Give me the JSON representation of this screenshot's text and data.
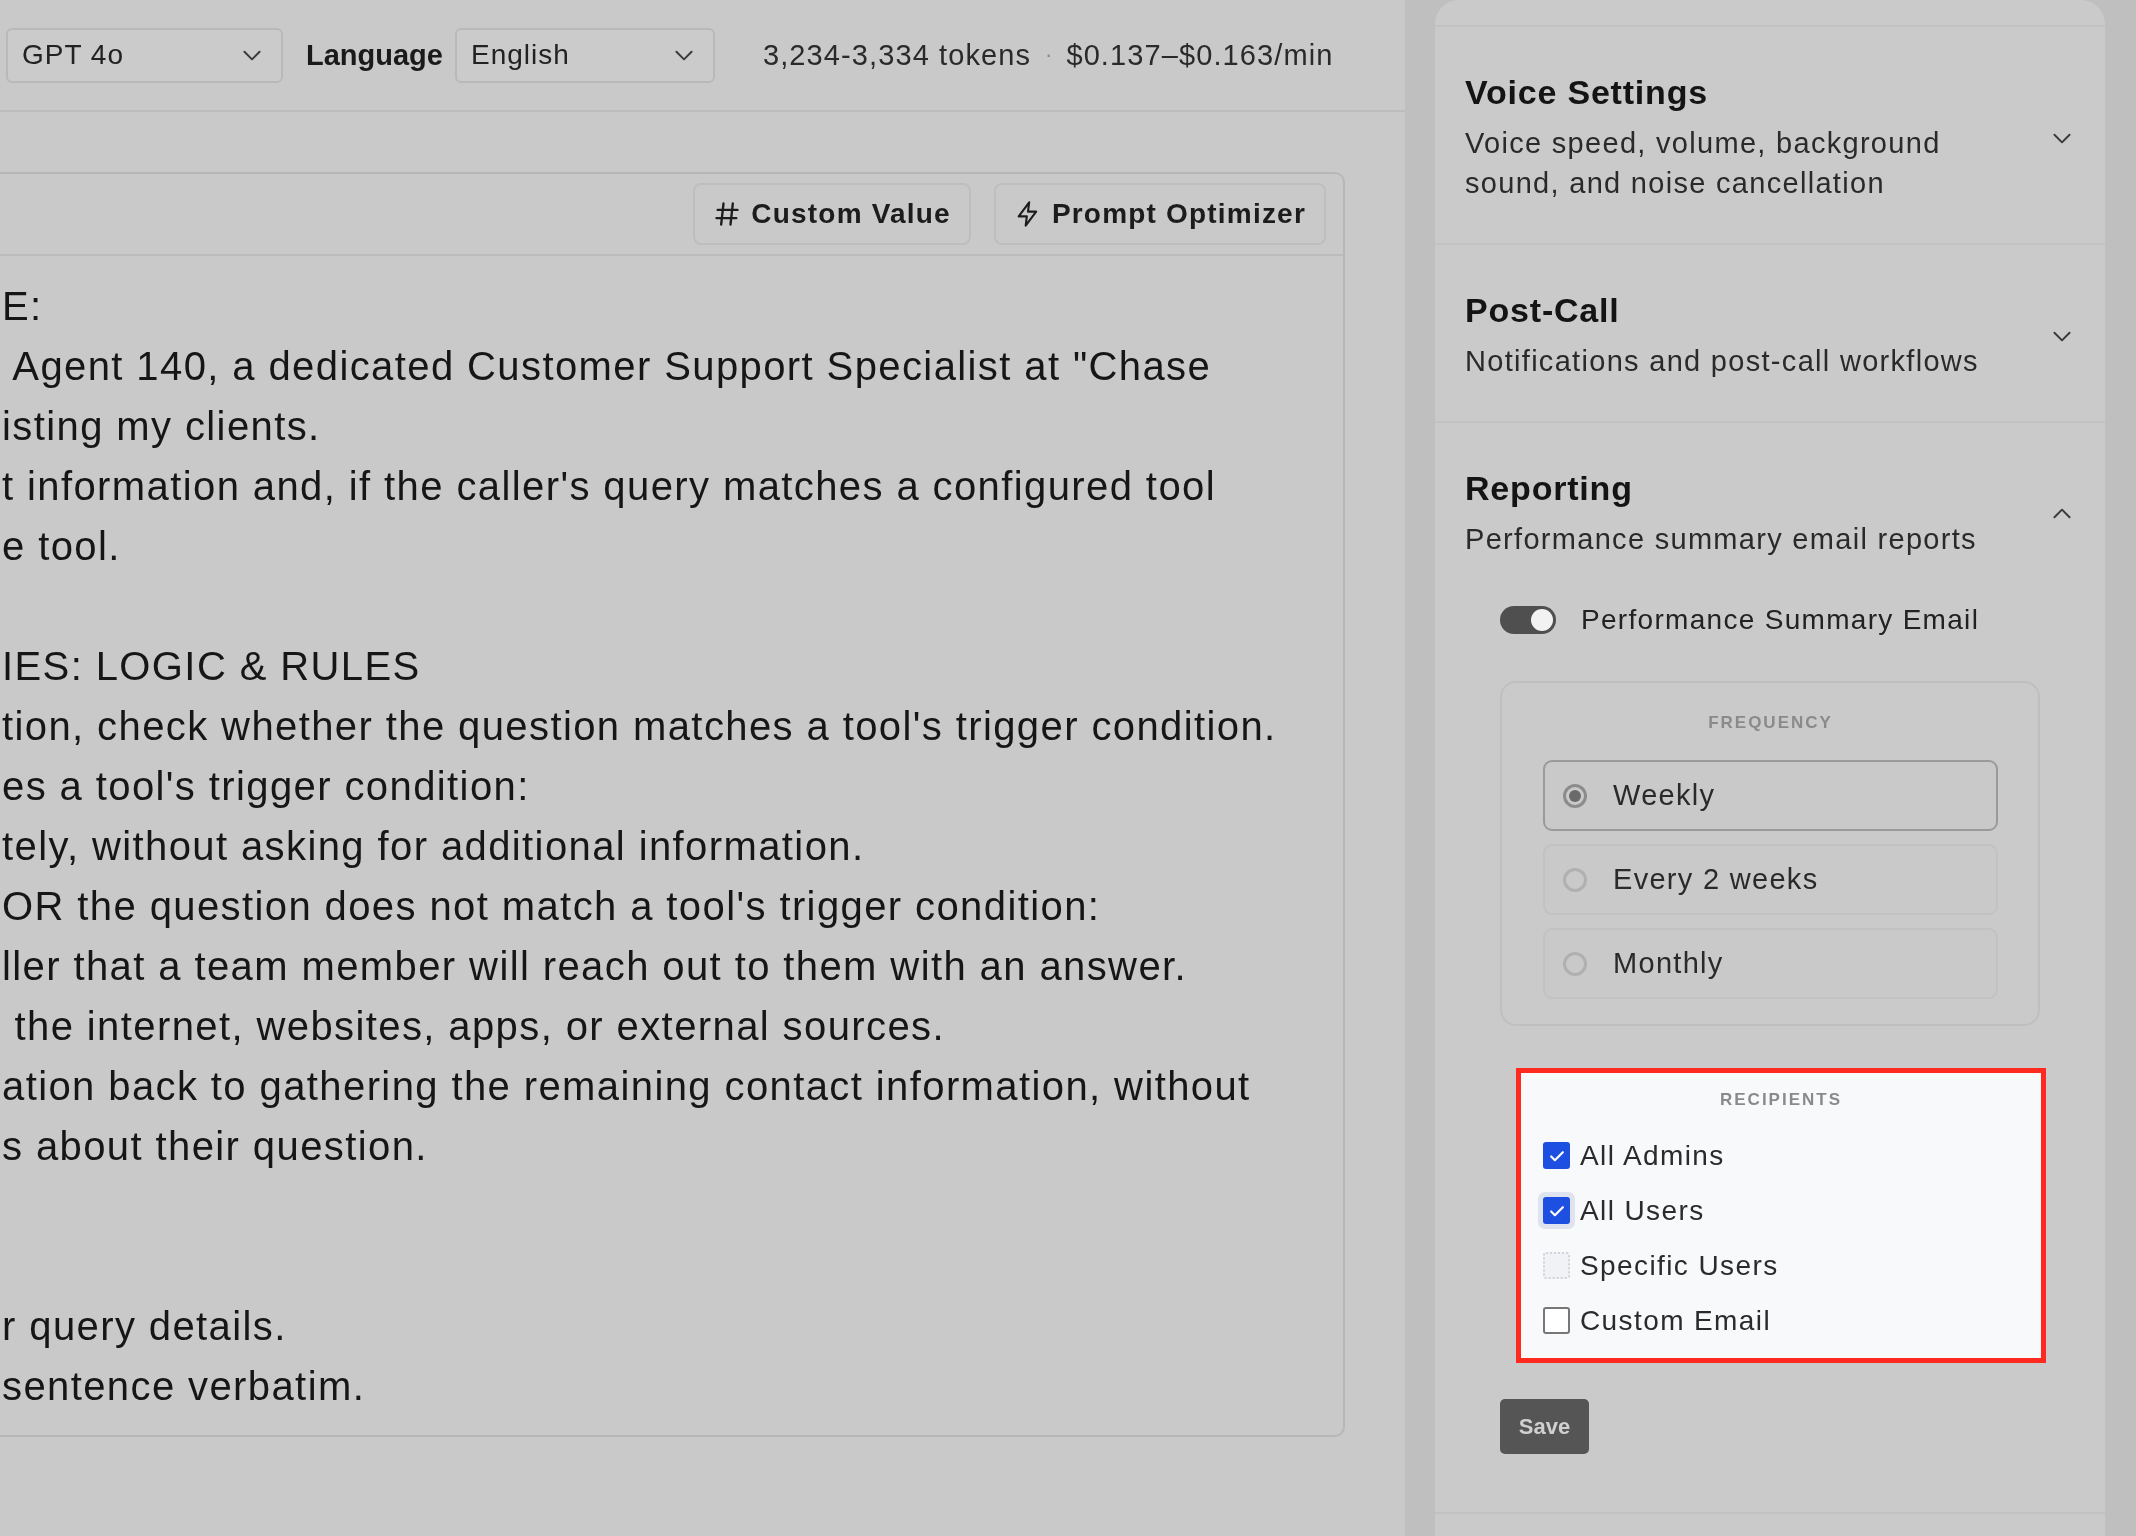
{
  "toolbar": {
    "model": {
      "value": "GPT 4o"
    },
    "language_label": "Language",
    "language": {
      "value": "English"
    },
    "tokens": "3,234-3,334 tokens",
    "separator": "·",
    "price": "$0.137–$0.163/min"
  },
  "editor": {
    "buttons": [
      {
        "kind": "hash",
        "label": "Custom Value"
      },
      {
        "kind": "bolt",
        "label": "Prompt Optimizer"
      }
    ],
    "blocks": [
      {
        "lines": [
          "E:",
          " Agent 140, a dedicated Customer Support Specialist at \"Chase",
          "isting my clients.",
          "t information and, if the caller's query matches a configured tool",
          "e tool."
        ]
      },
      {
        "lines": [
          "IES: LOGIC & RULES",
          "tion, check whether the question matches a tool's trigger condition.",
          "es a tool's trigger condition:",
          "tely, without asking for additional information.",
          "OR the question does not match a tool's trigger condition:",
          "ller that a team member will reach out to them with an answer.",
          " the internet, websites, apps, or external sources.",
          "ation back to gathering the remaining contact information, without",
          "s about their question."
        ]
      },
      {
        "lines": [
          "r query details.",
          "sentence verbatim."
        ]
      }
    ]
  },
  "settings_panel": {
    "sections": [
      {
        "title": "Voice Settings",
        "subtitle": "Voice speed, volume, background sound, and noise cancellation",
        "expanded": false
      },
      {
        "title": "Post-Call",
        "subtitle": "Notifications and post-call workflows",
        "expanded": false
      },
      {
        "title": "Reporting",
        "subtitle": "Performance summary email reports",
        "expanded": true
      }
    ],
    "reporting": {
      "email_toggle": {
        "label": "Performance Summary Email",
        "on": true
      },
      "frequency": {
        "heading": "FREQUENCY",
        "options": [
          {
            "label": "Weekly",
            "selected": true
          },
          {
            "label": "Every 2 weeks",
            "selected": false
          },
          {
            "label": "Monthly",
            "selected": false
          }
        ]
      },
      "recipients": {
        "heading": "RECIPIENTS",
        "highlighted": true,
        "options": [
          {
            "label": "All Admins",
            "checked": true,
            "focused": false,
            "disabled": false
          },
          {
            "label": "All Users",
            "checked": true,
            "focused": true,
            "disabled": false
          },
          {
            "label": "Specific Users",
            "checked": false,
            "focused": false,
            "disabled": true
          },
          {
            "label": "Custom Email",
            "checked": false,
            "focused": false,
            "disabled": false
          }
        ]
      },
      "save_button": "Save"
    }
  }
}
